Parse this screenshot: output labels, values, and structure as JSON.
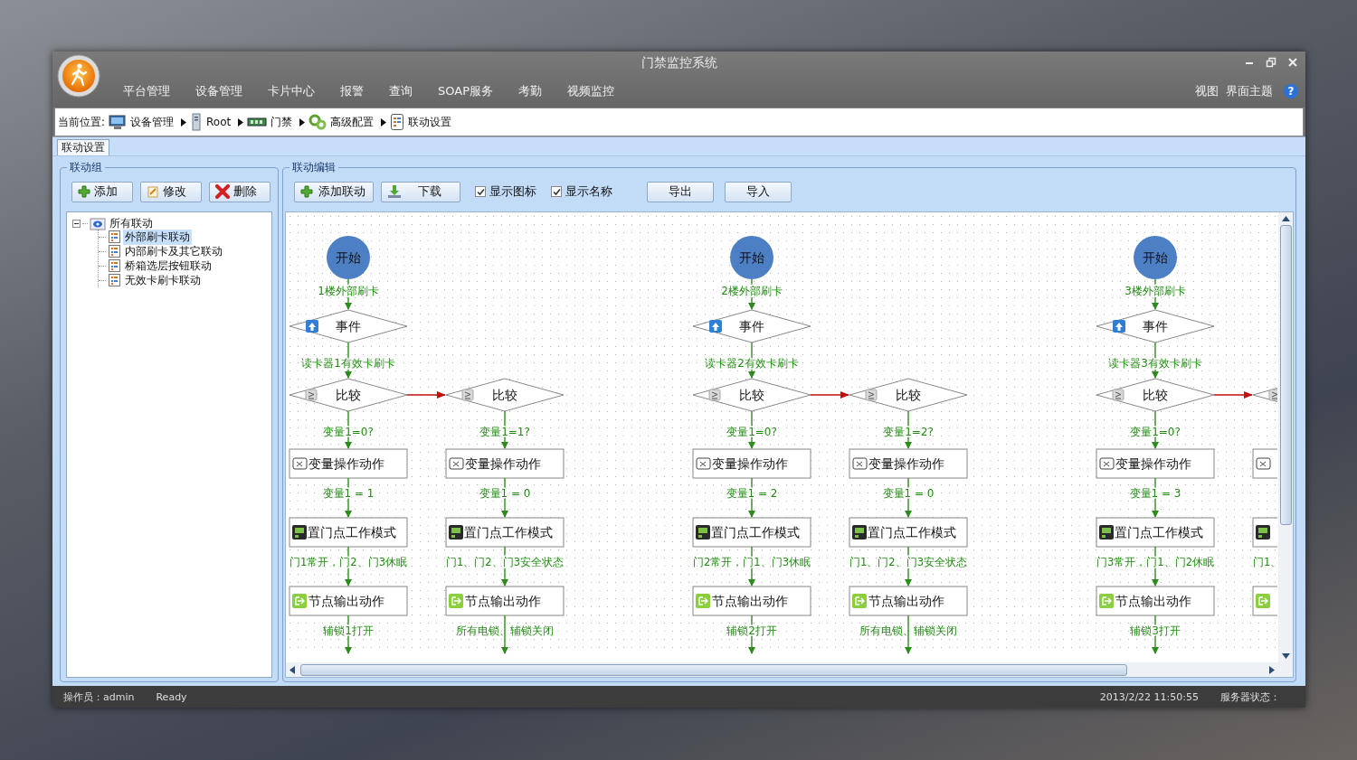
{
  "window": {
    "title": "门禁监控系统"
  },
  "menu": [
    "平台管理",
    "设备管理",
    "卡片中心",
    "报警",
    "查询",
    "SOAP服务",
    "考勤",
    "视频监控"
  ],
  "menu_right": [
    "视图",
    "界面主题"
  ],
  "help": "?",
  "breadcrumb": {
    "label": "当前位置:",
    "items": [
      {
        "text": "设备管理",
        "kind": "monitor"
      },
      {
        "text": "Root",
        "kind": "server"
      },
      {
        "text": "门禁",
        "kind": "board"
      },
      {
        "text": "高级配置",
        "kind": "gears"
      },
      {
        "text": "联动设置",
        "kind": "list"
      }
    ]
  },
  "tabs": [
    {
      "label": "联动设置",
      "selected": true
    }
  ],
  "group_panel": {
    "title": "联动组",
    "buttons": [
      {
        "label": "添加",
        "kind": "add"
      },
      {
        "label": "修改",
        "kind": "edit"
      },
      {
        "label": "删除",
        "kind": "delete"
      }
    ],
    "tree": {
      "label": "所有联动",
      "expanded": true,
      "children": [
        {
          "label": "外部刷卡联动",
          "selected": true
        },
        {
          "label": "内部刷卡及其它联动",
          "selected": false
        },
        {
          "label": "桥箱选层按钮联动",
          "selected": false
        },
        {
          "label": "无效卡刷卡联动",
          "selected": false
        }
      ]
    }
  },
  "editor_panel": {
    "title": "联动编辑",
    "buttons": [
      {
        "label": "添加联动",
        "kind": "add"
      },
      {
        "label": "下载",
        "kind": "download"
      }
    ],
    "checkboxes": [
      {
        "label": "显示图标",
        "checked": true
      },
      {
        "label": "显示名称",
        "checked": true
      }
    ],
    "plain_buttons": [
      "导出",
      "导入"
    ],
    "flows": [
      {
        "start": "开始",
        "trigger": "1楼外部刷卡",
        "event": "事件",
        "event_condition": "读卡器1有效卡刷卡",
        "branches": [
          {
            "compare": "比较",
            "condition": "变量1=0?",
            "var_action": "变量操作动作",
            "var_value": "变量1 = 1",
            "door_action": "置门点工作模式",
            "door_mode": "门1常开，门2、门3休眠",
            "output_action": "节点输出动作",
            "output_value": "辅锁1打开"
          },
          {
            "compare": "比较",
            "condition": "变量1=1?",
            "var_action": "变量操作动作",
            "var_value": "变量1 = 0",
            "door_action": "置门点工作模式",
            "door_mode": "门1、门2、门3安全状态",
            "output_action": "节点输出动作",
            "output_value": "所有电锁、辅锁关闭"
          }
        ]
      },
      {
        "start": "开始",
        "trigger": "2楼外部刷卡",
        "event": "事件",
        "event_condition": "读卡器2有效卡刷卡",
        "branches": [
          {
            "compare": "比较",
            "condition": "变量1=0?",
            "var_action": "变量操作动作",
            "var_value": "变量1 = 2",
            "door_action": "置门点工作模式",
            "door_mode": "门2常开，门1、门3休眠",
            "output_action": "节点输出动作",
            "output_value": "辅锁2打开"
          },
          {
            "compare": "比较",
            "condition": "变量1=2?",
            "var_action": "变量操作动作",
            "var_value": "变量1 = 0",
            "door_action": "置门点工作模式",
            "door_mode": "门1、门2、门3安全状态",
            "output_action": "节点输出动作",
            "output_value": "所有电锁、辅锁关闭"
          }
        ]
      },
      {
        "start": "开始",
        "trigger": "3楼外部刷卡",
        "event": "事件",
        "event_condition": "读卡器3有效卡刷卡",
        "branches": [
          {
            "compare": "比较",
            "condition": "变量1=0?",
            "var_action": "变量操作动作",
            "var_value": "变量1 = 3",
            "door_action": "置门点工作模式",
            "door_mode": "门3常开，门1、门2休眠",
            "output_action": "节点输出动作",
            "output_value": "辅锁3打开"
          },
          {
            "door_mode": "门1、"
          }
        ]
      }
    ]
  },
  "status_bar": {
    "operator": "操作员：admin",
    "state": "Ready",
    "time": "2013/2/22 11:50:55",
    "server": "服务器状态："
  }
}
